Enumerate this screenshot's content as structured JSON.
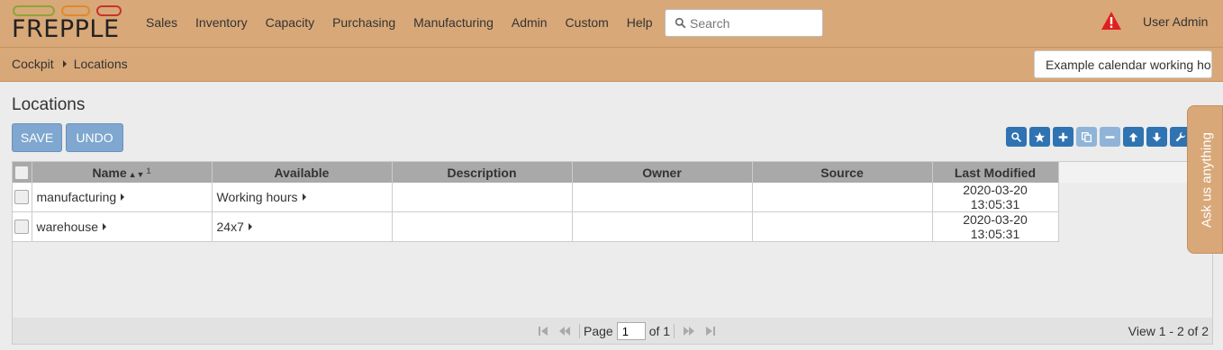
{
  "header": {
    "logo_text": "FREPPLE",
    "nav": [
      "Sales",
      "Inventory",
      "Capacity",
      "Purchasing",
      "Manufacturing",
      "Admin",
      "Custom",
      "Help"
    ],
    "search_placeholder": "Search",
    "user": "User Admin",
    "alert_color": "#e02020"
  },
  "breadcrumb": {
    "items": [
      "Cockpit",
      "Locations"
    ]
  },
  "tooltip_text": "Example calendar working hours",
  "page": {
    "title": "Locations",
    "save_label": "SAVE",
    "undo_label": "UNDO"
  },
  "toolbar_icons": [
    "search-icon",
    "star-icon",
    "plus-icon",
    "copy-icon",
    "minus-icon",
    "arrow-up-icon",
    "arrow-down-icon",
    "wrench-icon"
  ],
  "grid": {
    "columns": [
      "Name",
      "Available",
      "Description",
      "Owner",
      "Source",
      "Last Modified"
    ],
    "sort_indicator": "1",
    "rows": [
      {
        "name": "manufacturing",
        "available": "Working hours",
        "description": "",
        "owner": "",
        "source": "",
        "last_modified": "2020-03-20 13:05:31"
      },
      {
        "name": "warehouse",
        "available": "24x7",
        "description": "",
        "owner": "",
        "source": "",
        "last_modified": "2020-03-20 13:05:31"
      }
    ]
  },
  "pager": {
    "page_label": "Page",
    "page_value": "1",
    "of_label": "of 1",
    "view_info": "View 1 - 2 of 2"
  },
  "feedback_tab": "Ask us anything",
  "colors": {
    "brand": "#d8a878",
    "button": "#7fa7cf",
    "tool": "#2f73b2"
  }
}
